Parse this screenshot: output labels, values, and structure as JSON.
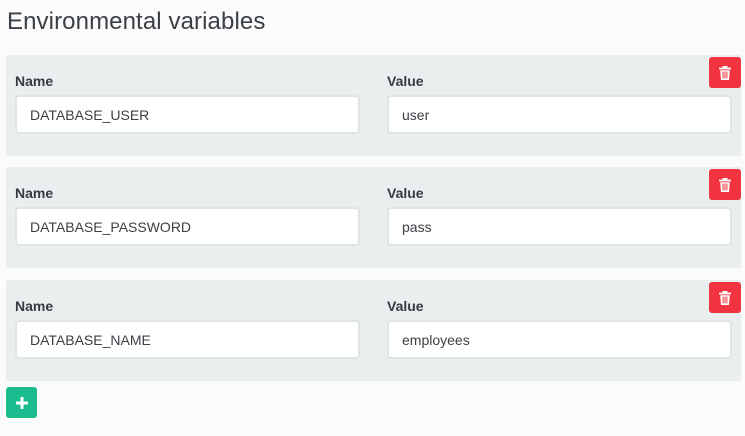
{
  "page": {
    "title": "Environmental variables"
  },
  "labels": {
    "name": "Name",
    "value": "Value"
  },
  "variables": [
    {
      "name": "DATABASE_USER",
      "value": "user"
    },
    {
      "name": "DATABASE_PASSWORD",
      "value": "pass"
    },
    {
      "name": "DATABASE_NAME",
      "value": "employees"
    }
  ],
  "icons": {
    "delete": "trash-icon",
    "add": "plus-icon"
  },
  "colors": {
    "delete_button": "#f13440",
    "add_button": "#1bbc8d",
    "card_background": "#e9eeee"
  }
}
